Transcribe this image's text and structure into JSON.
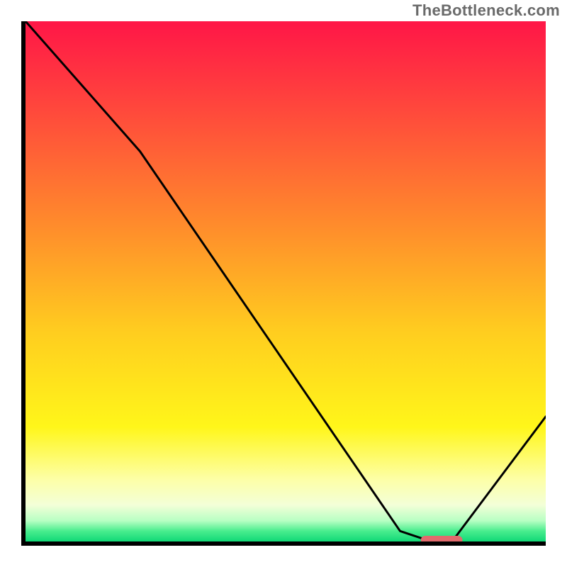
{
  "watermark": "TheBottleneck.com",
  "chart_data": {
    "type": "line",
    "title": "",
    "xlabel": "",
    "ylabel": "",
    "xlim": [
      0,
      100
    ],
    "ylim": [
      0,
      100
    ],
    "grid": false,
    "legend": false,
    "series": [
      {
        "name": "bottleneck-curve",
        "x": [
          0,
          22,
          72,
          78,
          82,
          100
        ],
        "y": [
          100,
          75,
          2,
          0,
          0,
          24
        ]
      }
    ],
    "markers": [
      {
        "name": "optimal-range",
        "x_start": 76,
        "x_end": 84,
        "y": 0,
        "color": "#e26a6d"
      }
    ],
    "background_gradient_stops": [
      {
        "offset": 0,
        "color": "#ff1647"
      },
      {
        "offset": 14,
        "color": "#ff3f3e"
      },
      {
        "offset": 40,
        "color": "#ff8e2b"
      },
      {
        "offset": 60,
        "color": "#ffce1f"
      },
      {
        "offset": 78,
        "color": "#fff61a"
      },
      {
        "offset": 88,
        "color": "#fdffa6"
      },
      {
        "offset": 93,
        "color": "#f3ffd8"
      },
      {
        "offset": 96,
        "color": "#b8ffc3"
      },
      {
        "offset": 98,
        "color": "#49ed8e"
      },
      {
        "offset": 100,
        "color": "#11d877"
      }
    ]
  }
}
